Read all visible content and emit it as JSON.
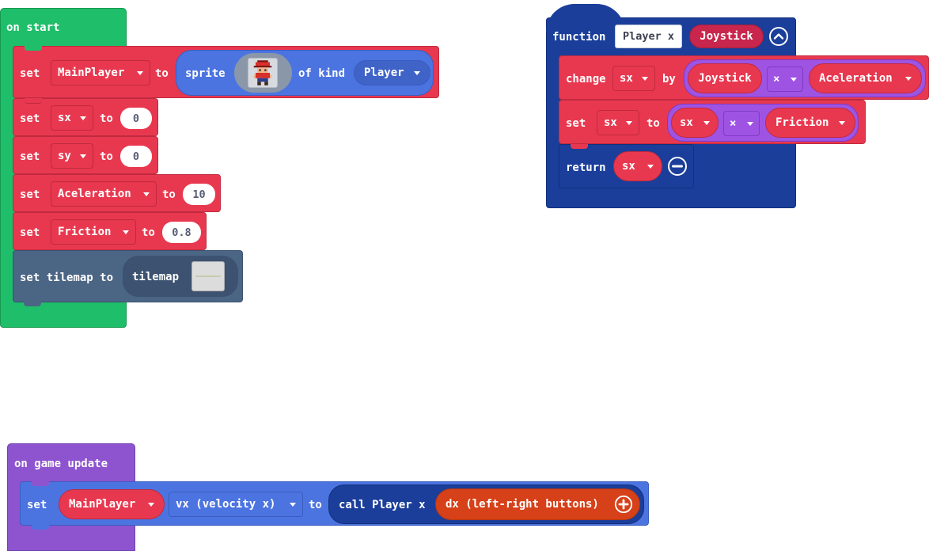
{
  "on_start": {
    "hat_label": "on start",
    "blocks": [
      {
        "kw": "set",
        "var": "MainPlayer",
        "to": "to",
        "sprite_label": "sprite",
        "of_kind_label": "of kind",
        "kind": "Player"
      },
      {
        "kw": "set",
        "var": "sx",
        "to": "to",
        "value": "0"
      },
      {
        "kw": "set",
        "var": "sy",
        "to": "to",
        "value": "0"
      },
      {
        "kw": "set",
        "var": "Aceleration",
        "to": "to",
        "value": "10"
      },
      {
        "kw": "set",
        "var": "Friction",
        "to": "to",
        "value": "0.8"
      },
      {
        "label": "set tilemap to",
        "tilemap_label": "tilemap"
      }
    ]
  },
  "function_block": {
    "function_label": "function",
    "name": "Player x",
    "param": "Joystick",
    "change_label": "change",
    "change_var": "sx",
    "by_label": "by",
    "change_left": "Joystick",
    "change_op": "×",
    "change_right": "Aceleration",
    "set_label": "set",
    "set_var": "sx",
    "to_label": "to",
    "set_left": "sx",
    "set_op": "×",
    "set_right": "Friction",
    "return_label": "return",
    "return_var": "sx"
  },
  "game_update": {
    "hat_label": "on game update",
    "set_label": "set",
    "sprite_var": "MainPlayer",
    "property": "vx (velocity x)",
    "to_label": "to",
    "call_label": "call Player x",
    "arg": "dx (left-right buttons)"
  },
  "colors": {
    "loops_green": "#1fbe6a",
    "variables_red": "#e8384f",
    "sprites_blue": "#4c74e1",
    "scene_slate": "#4b6584",
    "functions_navy": "#1a3e9a",
    "math_purple": "#9f53e3",
    "game_purple": "#8e54cf",
    "controller_orange": "#d64119"
  }
}
